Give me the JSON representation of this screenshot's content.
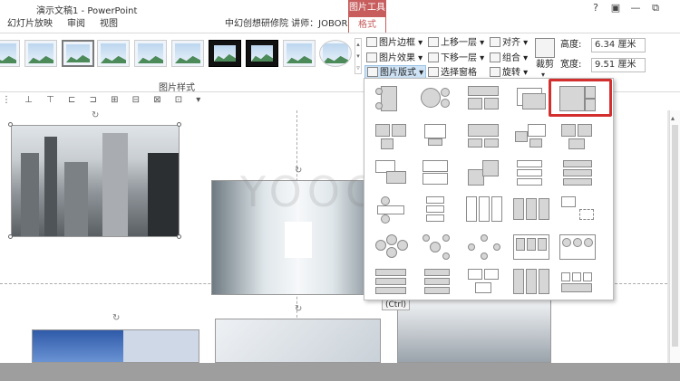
{
  "window": {
    "title": "演示文稿1 - PowerPoint",
    "context_tab_group": "图片工具",
    "controls": [
      "?",
      "▣",
      "—",
      "⧉"
    ]
  },
  "tabs": {
    "slideshow": "幻灯片放映",
    "review": "审阅",
    "view": "视图",
    "presenter_info": "中幻创想研修院 讲师：JOBOR",
    "format": "格式"
  },
  "ribbon": {
    "picture_border": "图片边框",
    "picture_effects": "图片效果",
    "picture_layout": "图片版式",
    "bring_forward": "上移一层",
    "send_backward": "下移一层",
    "selection_pane": "选择窗格",
    "align": "对齐",
    "group": "组合",
    "rotate": "旋转",
    "crop": "裁剪",
    "height_label": "高度:",
    "height_value": "6.34 厘米",
    "width_label": "宽度:",
    "width_value": "9.51 厘米",
    "group_label": "图片样式"
  },
  "slide": {
    "watermark": "YOOOT",
    "paste_options": "(Ctrl)"
  },
  "colors": {
    "accent": "#c75d5d",
    "highlight": "#d32f2f"
  }
}
